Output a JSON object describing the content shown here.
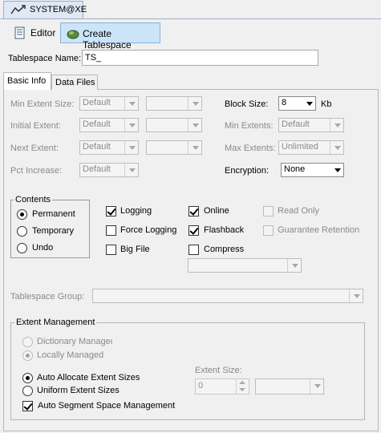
{
  "connection_tab": {
    "label": "SYSTEM@XE",
    "icon": "db-connection-icon"
  },
  "toolbar": {
    "editor_label": "Editor",
    "create_label": "Create Tablespace"
  },
  "form": {
    "name_label": "Tablespace Name:",
    "name_value": "TS_"
  },
  "tabs": {
    "basic": "Basic Info",
    "files": "Data Files"
  },
  "basic": {
    "min_extent_size": {
      "label": "Min Extent Size:",
      "value": "Default"
    },
    "initial_extent": {
      "label": "Initial Extent:",
      "value": "Default"
    },
    "next_extent": {
      "label": "Next Extent:",
      "value": "Default"
    },
    "pct_increase": {
      "label": "Pct Increase:",
      "value": "Default"
    },
    "block_size": {
      "label": "Block Size:",
      "value": "8",
      "unit": "Kb"
    },
    "min_extents": {
      "label": "Min Extents:",
      "value": "Default"
    },
    "max_extents": {
      "label": "Max Extents:",
      "value": "Unlimited"
    },
    "encryption": {
      "label": "Encryption:",
      "value": "None"
    }
  },
  "contents": {
    "title": "Contents",
    "options": [
      "Permanent",
      "Temporary",
      "Undo"
    ],
    "selected": "Permanent"
  },
  "options": {
    "logging": {
      "label": "Logging",
      "checked": true
    },
    "force_logging": {
      "label": "Force Logging",
      "checked": false
    },
    "big_file": {
      "label": "Big File",
      "checked": false
    },
    "online": {
      "label": "Online",
      "checked": true
    },
    "flashback": {
      "label": "Flashback",
      "checked": true
    },
    "compress": {
      "label": "Compress",
      "checked": false
    },
    "read_only": {
      "label": "Read Only",
      "checked": false
    },
    "guarantee_retention": {
      "label": "Guarantee Retention",
      "checked": false
    }
  },
  "tablespace_group": {
    "label": "Tablespace Group:",
    "value": ""
  },
  "extent_management": {
    "title": "Extent Management",
    "dictionary": "Dictionary Managed",
    "locally": "Locally Managed",
    "auto_allocate": "Auto Allocate Extent Sizes",
    "uniform": "Uniform Extent Sizes",
    "extent_size_label": "Extent Size:",
    "extent_size_value": "0",
    "auto_segment": "Auto Segment Space Management"
  }
}
